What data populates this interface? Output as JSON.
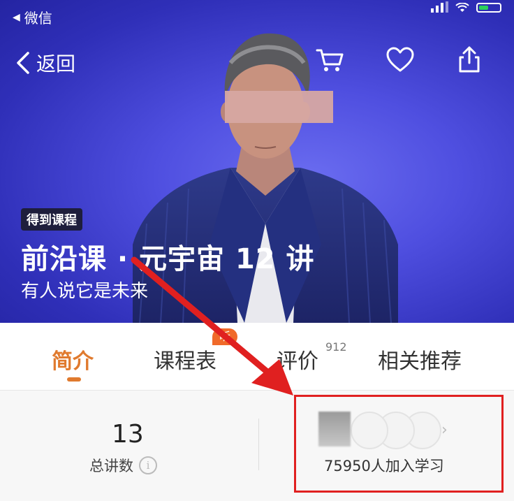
{
  "status": {
    "back_app": "微信"
  },
  "nav": {
    "back_label": "返回"
  },
  "hero": {
    "tag": "得到课程",
    "title": "前沿课 · 元宇宙 12 讲",
    "subtitle": "有人说它是未来"
  },
  "tabs": [
    {
      "label": "简介"
    },
    {
      "label": "课程表"
    },
    {
      "label": "评价"
    },
    {
      "label": "相关推荐"
    }
  ],
  "tab_badge": "听",
  "review_count": "912",
  "stats": {
    "lecture_count": "13",
    "lecture_label": "总讲数",
    "info_glyph": "i",
    "learners_text": "75950人加入学习"
  },
  "colors": {
    "accent": "#e07a2e",
    "annotation_red": "#e02020",
    "hero_blue": "#4f4fe0"
  }
}
